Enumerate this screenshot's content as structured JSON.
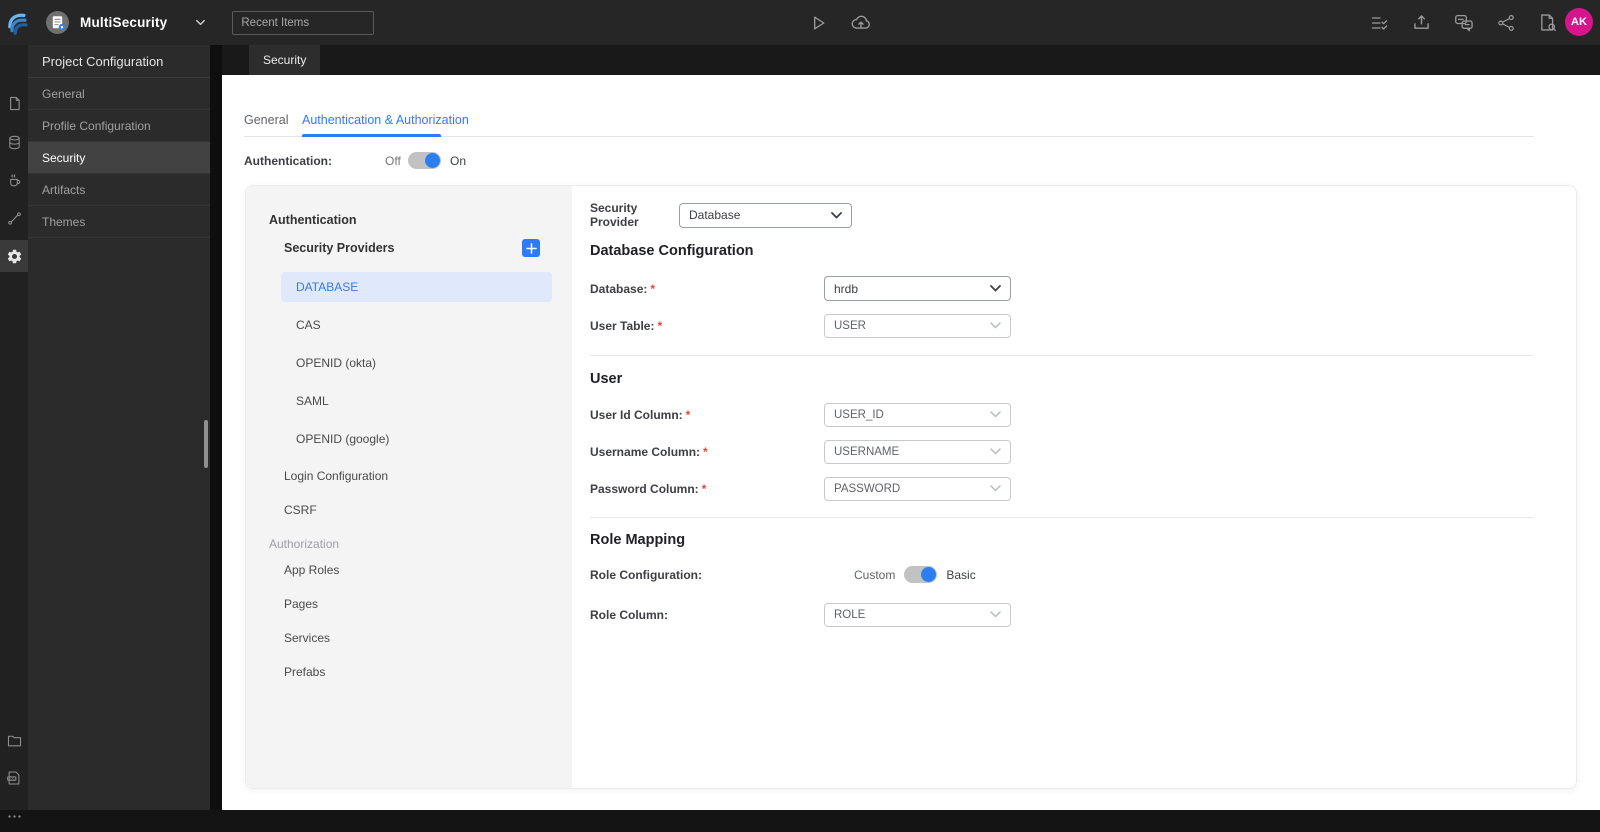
{
  "colors": {
    "accent_blue": "#2f7bf6",
    "avatar_pink": "#d6148c",
    "selected_item_bg": "#dfe9fb",
    "selected_item_text": "#3b79e3",
    "toggle_track": "#c2c2c2",
    "required_red": "#e8453c",
    "topbar_bg": "#262626",
    "sidenav_bg": "#2b2b2b"
  },
  "topbar": {
    "project_name": "MultiSecurity",
    "recent_items_placeholder": "Recent Items",
    "avatar_initials": "AK"
  },
  "sidebar": {
    "title": "Project Configuration",
    "items": [
      {
        "label": "General"
      },
      {
        "label": "Profile Configuration"
      },
      {
        "label": "Security"
      },
      {
        "label": "Artifacts"
      },
      {
        "label": "Themes"
      }
    ],
    "active_item": "Security"
  },
  "workspace_tab": "Security",
  "main": {
    "tabs": [
      {
        "label": "General"
      },
      {
        "label": "Authentication & Authorization"
      }
    ],
    "active_tab": "Authentication & Authorization",
    "authentication": {
      "label": "Authentication:",
      "off": "Off",
      "on": "On",
      "state": "On"
    },
    "nav": {
      "section_authentication": "Authentication",
      "security_providers": "Security Providers",
      "providers": [
        {
          "label": "DATABASE"
        },
        {
          "label": "CAS"
        },
        {
          "label": "OPENID (okta)"
        },
        {
          "label": "SAML"
        },
        {
          "label": "OPENID (google)"
        }
      ],
      "selected_provider": "DATABASE",
      "login_configuration": "Login Configuration",
      "csrf": "CSRF",
      "section_authorization": "Authorization",
      "authorization_items": [
        {
          "label": "App Roles"
        },
        {
          "label": "Pages"
        },
        {
          "label": "Services"
        },
        {
          "label": "Prefabs"
        }
      ]
    },
    "form": {
      "provider": {
        "label": "Security Provider",
        "value": "Database"
      },
      "sections": [
        {
          "title": "Database Configuration",
          "rows": [
            {
              "label": "Database:",
              "required": "*",
              "value": "hrdb"
            },
            {
              "label": "User Table:",
              "required": "*",
              "value": "USER"
            }
          ]
        },
        {
          "title": "User",
          "rows": [
            {
              "label": "User Id Column:",
              "required": "*",
              "value": "USER_ID"
            },
            {
              "label": "Username Column:",
              "required": "*",
              "value": "USERNAME"
            },
            {
              "label": "Password Column:",
              "required": "*",
              "value": "PASSWORD"
            }
          ]
        },
        {
          "title": "Role Mapping",
          "rows": [
            {
              "label": "Role Configuration:",
              "required": "",
              "toggle": {
                "left": "Custom",
                "right": "Basic",
                "state": "Basic"
              }
            },
            {
              "label": "Role Column:",
              "required": "",
              "value": "ROLE"
            }
          ]
        }
      ]
    }
  }
}
